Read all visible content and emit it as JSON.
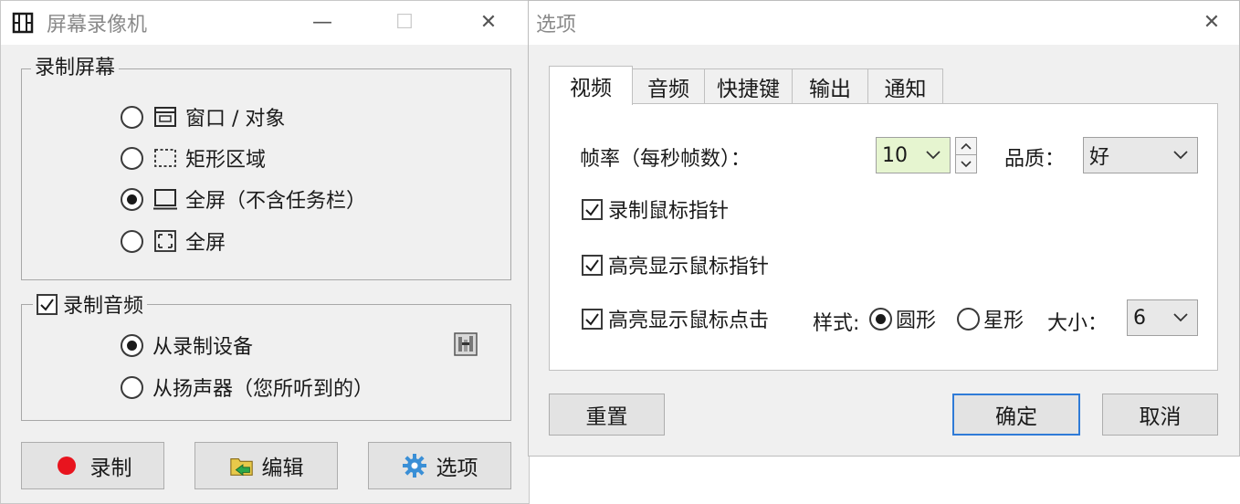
{
  "main_window": {
    "title": "屏幕录像机",
    "minimize": "—",
    "maximize": "☐",
    "close": "✕",
    "record_group": {
      "legend": "录制屏幕",
      "options": [
        {
          "label": "窗口 / 对象",
          "selected": false
        },
        {
          "label": "矩形区域",
          "selected": false
        },
        {
          "label": "全屏（不含任务栏）",
          "selected": true
        },
        {
          "label": "全屏",
          "selected": false
        }
      ]
    },
    "audio_group": {
      "legend": "录制音频",
      "checked": true,
      "options": [
        {
          "label": "从录制设备",
          "selected": true
        },
        {
          "label": "从扬声器（您所听到的）",
          "selected": false
        }
      ]
    },
    "buttons": {
      "record": "录制",
      "edit": "编辑",
      "options": "选项"
    }
  },
  "options_dialog": {
    "title": "选项",
    "close": "✕",
    "tabs": [
      {
        "label": "视频",
        "active": true
      },
      {
        "label": "音频",
        "active": false
      },
      {
        "label": "快捷键",
        "active": false
      },
      {
        "label": "输出",
        "active": false
      },
      {
        "label": "通知",
        "active": false
      }
    ],
    "video": {
      "framerate_label": "帧率（每秒帧数）：",
      "framerate_value": "10",
      "quality_label": "品质：",
      "quality_value": "好",
      "record_cursor": {
        "label": "录制鼠标指针",
        "checked": true
      },
      "highlight_cursor": {
        "label": "高亮显示鼠标指针",
        "checked": true
      },
      "highlight_click": {
        "label": "高亮显示鼠标点击",
        "checked": true
      },
      "style_label": "样式:",
      "style_options": [
        {
          "label": "圆形",
          "selected": true
        },
        {
          "label": "星形",
          "selected": false
        }
      ],
      "size_label": "大小：",
      "size_value": "6"
    },
    "buttons": {
      "reset": "重置",
      "ok": "确定",
      "cancel": "取消"
    }
  },
  "colors": {
    "record_dot": "#e8141e",
    "default_button_border": "#2f7bd7",
    "spinner_highlight": "#e6f5d0"
  }
}
